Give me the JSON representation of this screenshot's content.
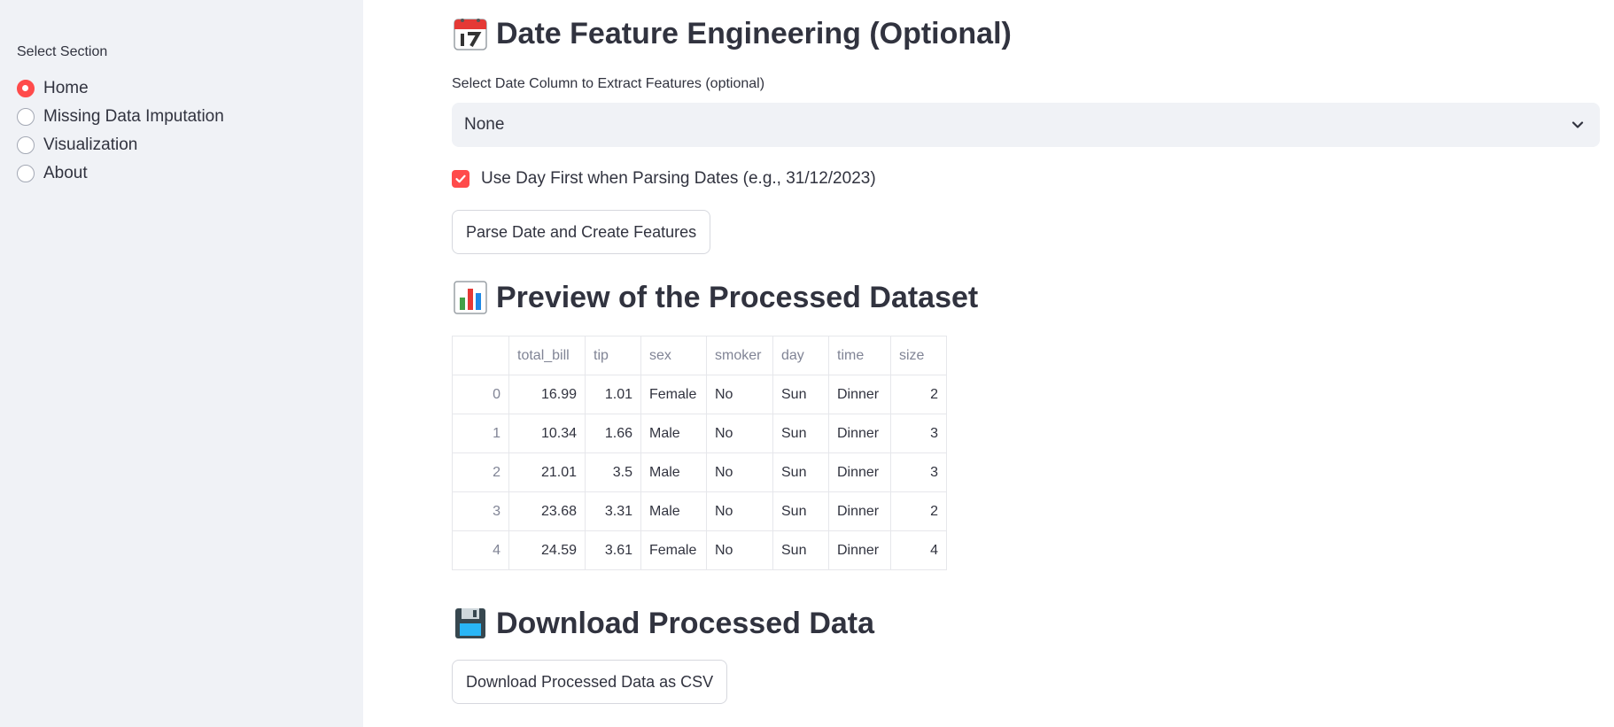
{
  "sidebar": {
    "title": "Select Section",
    "options": [
      {
        "label": "Home",
        "selected": true
      },
      {
        "label": "Missing Data Imputation",
        "selected": false
      },
      {
        "label": "Visualization",
        "selected": false
      },
      {
        "label": "About",
        "selected": false
      }
    ]
  },
  "date_section": {
    "heading": "Date Feature Engineering (Optional)",
    "icon": "calendar-icon",
    "select_label": "Select Date Column to Extract Features (optional)",
    "select_value": "None",
    "checkbox_label": "Use Day First when Parsing Dates (e.g., 31/12/2023)",
    "checkbox_checked": true,
    "button_label": "Parse Date and Create Features"
  },
  "preview_section": {
    "heading": "Preview of the Processed Dataset",
    "icon": "bar-chart-icon",
    "table": {
      "columns": [
        "",
        "total_bill",
        "tip",
        "sex",
        "smoker",
        "day",
        "time",
        "size"
      ],
      "rows": [
        [
          "0",
          "16.99",
          "1.01",
          "Female",
          "No",
          "Sun",
          "Dinner",
          "2"
        ],
        [
          "1",
          "10.34",
          "1.66",
          "Male",
          "No",
          "Sun",
          "Dinner",
          "3"
        ],
        [
          "2",
          "21.01",
          "3.5",
          "Male",
          "No",
          "Sun",
          "Dinner",
          "3"
        ],
        [
          "3",
          "23.68",
          "3.31",
          "Male",
          "No",
          "Sun",
          "Dinner",
          "2"
        ],
        [
          "4",
          "24.59",
          "3.61",
          "Female",
          "No",
          "Sun",
          "Dinner",
          "4"
        ]
      ]
    }
  },
  "download_section": {
    "heading": "Download Processed Data",
    "icon": "floppy-disk-icon",
    "button_label": "Download Processed Data as CSV"
  },
  "colors": {
    "accent": "#ff4b4b",
    "sidebar_bg": "#f0f2f6",
    "text": "#31333f"
  }
}
